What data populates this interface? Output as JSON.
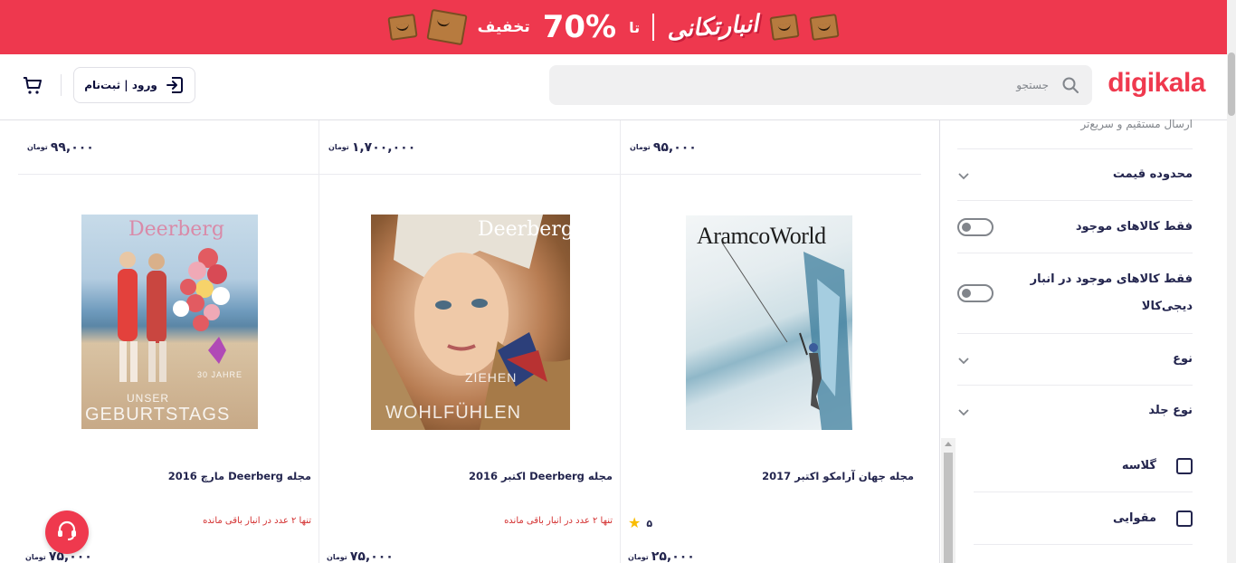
{
  "banner": {
    "brand": "انبارتکانی",
    "upto": "تا",
    "percent": "70%",
    "off": "تخفیف"
  },
  "header": {
    "logo": "digikala",
    "search_placeholder": "جستجو",
    "login_label": "ورود | ثبت‌نام"
  },
  "currency": "تومان",
  "price_row": [
    "۹۹,۰۰۰",
    "۱,۷۰۰,۰۰۰",
    "۹۵,۰۰۰"
  ],
  "products": [
    {
      "title": "مجله Deerberg مارچ 2016",
      "stock": "تنها ۲ عدد در انبار باقی مانده",
      "rating": "",
      "price": "۷۵,۰۰۰",
      "cover_brand": "Deerberg",
      "cover_text_1": "30 JAHRE",
      "cover_text_2": "UNSER",
      "cover_text_3": "GEBURTSTAGS"
    },
    {
      "title": "مجله Deerberg اکتبر 2016",
      "stock": "تنها ۲ عدد در انبار باقی مانده",
      "rating": "",
      "price": "۷۵,۰۰۰",
      "cover_brand": "Deerberg",
      "cover_text_1": "ZIEHEN",
      "cover_text_2": "WOHLFÜHLEN"
    },
    {
      "title": "مجله جهان آرامکو اکتبر 2017",
      "stock": "",
      "rating": "۵",
      "price": "۲۵,۰۰۰",
      "cover_brand": "AramcoWorld"
    }
  ],
  "sidebar": {
    "shipping_faded": "ارسال مستقیم و سریع‌تر",
    "price_range": "محدوده قیمت",
    "only_available": "فقط کالاهای موجود",
    "only_warehouse": "فقط کالاهای موجود در انبار دیجی‌کالا",
    "type": "نوع",
    "binding_type": "نوع جلد",
    "binding_options": [
      "گلاسه",
      "مقوایی"
    ]
  },
  "colors": {
    "brand_red": "#ef394e",
    "banner_red": "#ee384e",
    "text_dark": "#23254e",
    "warning_red": "#d32f2f",
    "star_yellow": "#f9bc00"
  }
}
